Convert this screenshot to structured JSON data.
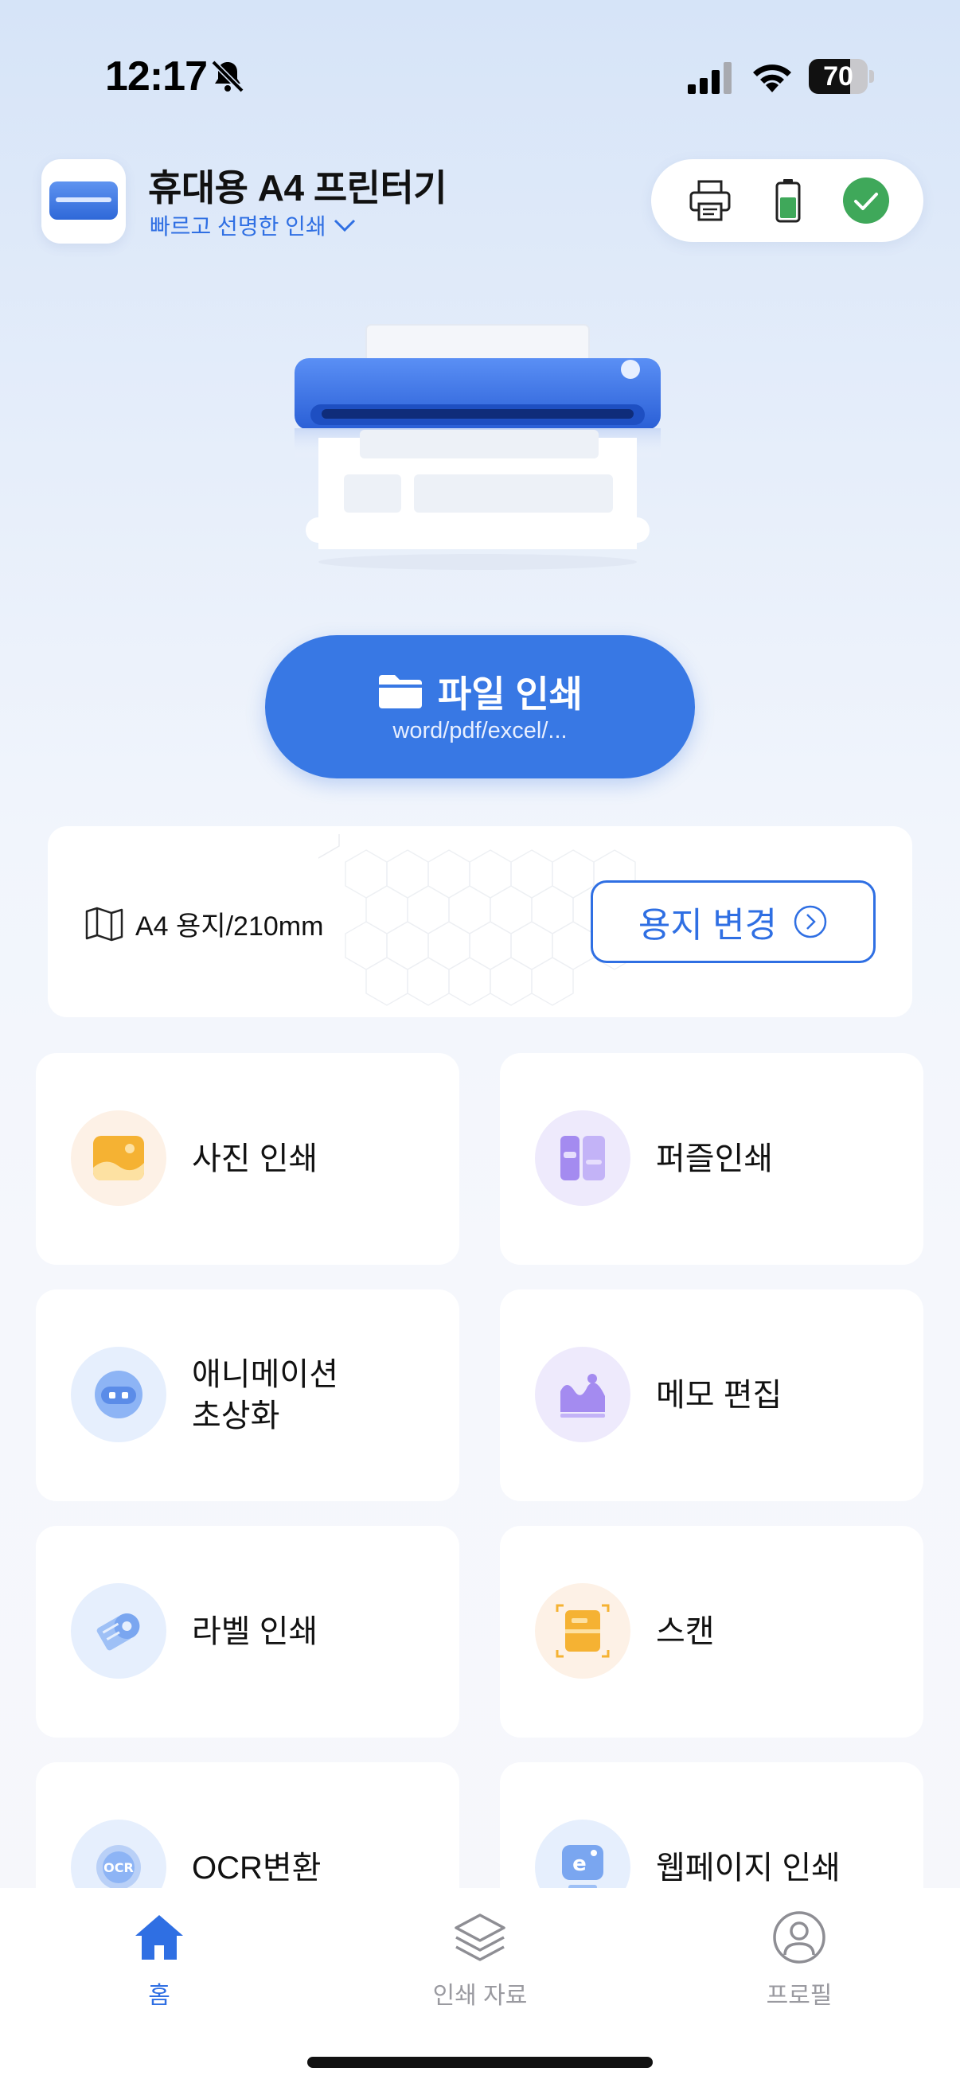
{
  "status_bar": {
    "time": "12:17",
    "battery_level": "70",
    "battery_fraction": 0.7
  },
  "header": {
    "title": "휴대용 A4 프린터기",
    "subtitle": "빠르고 선명한 인쇄",
    "status_icons": [
      "printer-icon",
      "battery-icon",
      "connected-check-icon"
    ],
    "colors": {
      "accent": "#2f6fe3",
      "check": "#3fa85a"
    }
  },
  "file_print": {
    "label": "파일 인쇄",
    "formats": "word/pdf/excel/..."
  },
  "paper": {
    "current": "A4 용지/210mm",
    "change_label": "용지 변경"
  },
  "features": [
    {
      "label": "사진 인쇄",
      "icon": "photo-icon"
    },
    {
      "label": "퍼즐인쇄",
      "icon": "puzzle-icon"
    },
    {
      "label": "애니메이션\n초상화",
      "icon": "anime-portrait-icon"
    },
    {
      "label": "메모 편집",
      "icon": "memo-icon"
    },
    {
      "label": "라벨 인쇄",
      "icon": "label-icon"
    },
    {
      "label": "스캔",
      "icon": "scan-icon"
    },
    {
      "label": "OCR변환",
      "icon": "ocr-icon"
    },
    {
      "label": "웹페이지 인쇄",
      "icon": "webpage-icon"
    }
  ],
  "tabs": [
    {
      "label": "홈",
      "icon": "home-icon",
      "active": true
    },
    {
      "label": "인쇄 자료",
      "icon": "layers-icon",
      "active": false
    },
    {
      "label": "프로필",
      "icon": "profile-icon",
      "active": false
    }
  ]
}
